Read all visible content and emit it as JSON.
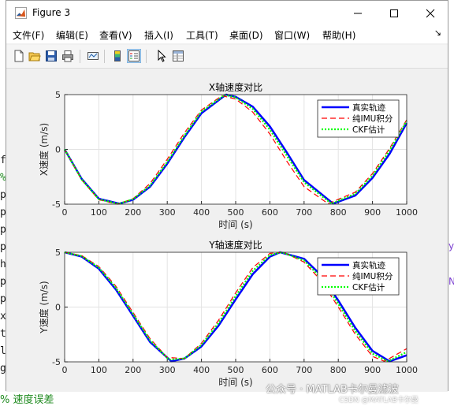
{
  "window": {
    "title": "Figure 3"
  },
  "menu": [
    "文件(F)",
    "编辑(E)",
    "查看(V)",
    "插入(I)",
    "工具(T)",
    "桌面(D)",
    "窗口(W)",
    "帮助(H)"
  ],
  "toolbar": [
    "new-figure-icon",
    "open-file-icon",
    "save-icon",
    "print-icon",
    "link-plot-icon",
    "insert-colorbar-icon",
    "insert-legend-icon",
    "pointer-icon",
    "property-inspector-icon"
  ],
  "background_editor": {
    "left_chars": [
      "f",
      "%",
      "p",
      "p",
      "p",
      "p",
      "h",
      "p",
      "p",
      "x",
      "t",
      "l",
      "g"
    ],
    "bottom_text": "% 速度误差",
    "right_chars": [
      "y",
      "N"
    ]
  },
  "watermark": {
    "text": "公众号 · MATLAB卡尔曼滤波",
    "sub": "CSDN @MATLAB卡尔曼"
  },
  "chart_data": [
    {
      "type": "line",
      "title": "X轴速度对比",
      "xlabel": "时间 (s)",
      "ylabel": "X速度 (m/s)",
      "xlim": [
        0,
        1000
      ],
      "ylim": [
        -5,
        5
      ],
      "xticks": [
        "0",
        "100",
        "200",
        "300",
        "400",
        "500",
        "600",
        "700",
        "800",
        "900",
        "1000"
      ],
      "yticks": [
        "-5",
        "0",
        "5"
      ],
      "grid": true,
      "legend_position": "top-right",
      "series": [
        {
          "name": "真实轨迹",
          "color": "#0000ff",
          "style": "solid",
          "x": [
            0,
            50,
            100,
            160,
            200,
            250,
            300,
            350,
            400,
            472,
            500,
            550,
            600,
            650,
            700,
            785,
            850,
            900,
            950,
            1000
          ],
          "y": [
            0,
            -2.7,
            -4.5,
            -4.95,
            -4.6,
            -3.4,
            -1.3,
            1.1,
            3.3,
            5.0,
            4.8,
            3.9,
            2.1,
            -0.3,
            -2.8,
            -4.95,
            -4.2,
            -2.6,
            -0.4,
            2.4
          ]
        },
        {
          "name": "纯IMU积分",
          "color": "#ff0000",
          "style": "dashed",
          "x": [
            0,
            50,
            100,
            155,
            200,
            250,
            300,
            350,
            400,
            460,
            500,
            550,
            600,
            650,
            700,
            770,
            850,
            900,
            950,
            1000
          ],
          "y": [
            0,
            -2.8,
            -4.6,
            -5.0,
            -4.5,
            -3.1,
            -0.9,
            1.5,
            3.6,
            4.9,
            4.6,
            3.4,
            1.4,
            -1.1,
            -3.4,
            -4.95,
            -3.9,
            -2.2,
            0.1,
            2.7
          ]
        },
        {
          "name": "CKF估计",
          "color": "#00ff00",
          "style": "dotted",
          "x": [
            0,
            50,
            100,
            158,
            200,
            250,
            300,
            350,
            400,
            468,
            500,
            550,
            600,
            650,
            700,
            780,
            850,
            900,
            950,
            1000
          ],
          "y": [
            0,
            -2.75,
            -4.55,
            -4.97,
            -4.55,
            -3.3,
            -1.15,
            1.25,
            3.45,
            4.97,
            4.75,
            3.7,
            1.8,
            -0.6,
            -3.0,
            -4.95,
            -4.05,
            -2.4,
            -0.1,
            2.6
          ]
        }
      ]
    },
    {
      "type": "line",
      "title": "Y轴速度对比",
      "xlabel": "时间 (s)",
      "ylabel": "Y速度 (m/s)",
      "xlim": [
        0,
        1000
      ],
      "ylim": [
        -5,
        5
      ],
      "xticks": [
        "0",
        "100",
        "200",
        "300",
        "400",
        "500",
        "600",
        "700",
        "800",
        "900",
        "1000"
      ],
      "yticks": [
        "-5",
        "0",
        "5"
      ],
      "grid": true,
      "legend_position": "top-right",
      "series": [
        {
          "name": "真实轨迹",
          "color": "#0000ff",
          "style": "solid",
          "x": [
            0,
            50,
            100,
            150,
            200,
            250,
            312,
            350,
            400,
            450,
            500,
            550,
            600,
            630,
            700,
            750,
            800,
            850,
            900,
            950,
            1000
          ],
          "y": [
            5.0,
            4.6,
            3.5,
            1.6,
            -0.8,
            -3.2,
            -4.95,
            -4.7,
            -3.6,
            -1.7,
            0.7,
            3.0,
            4.6,
            5.0,
            4.4,
            2.9,
            0.6,
            -1.9,
            -4.0,
            -4.95,
            -4.4
          ]
        },
        {
          "name": "纯IMU积分",
          "color": "#ff0000",
          "style": "dashed",
          "x": [
            0,
            50,
            100,
            150,
            200,
            250,
            300,
            350,
            400,
            450,
            500,
            550,
            600,
            640,
            700,
            750,
            800,
            850,
            900,
            935,
            1000
          ],
          "y": [
            5.0,
            4.7,
            3.7,
            1.9,
            -0.5,
            -2.9,
            -4.6,
            -4.7,
            -3.3,
            -1.2,
            1.3,
            3.6,
            4.9,
            5.0,
            4.1,
            2.4,
            0.0,
            -2.5,
            -4.5,
            -4.95,
            -3.8
          ]
        },
        {
          "name": "CKF估计",
          "color": "#00ff00",
          "style": "dotted",
          "x": [
            0,
            50,
            100,
            150,
            200,
            250,
            305,
            350,
            400,
            450,
            500,
            550,
            600,
            635,
            700,
            750,
            800,
            850,
            900,
            945,
            1000
          ],
          "y": [
            5.0,
            4.65,
            3.6,
            1.75,
            -0.65,
            -3.05,
            -4.8,
            -4.7,
            -3.45,
            -1.45,
            1.0,
            3.3,
            4.75,
            5.0,
            4.25,
            2.65,
            0.3,
            -2.2,
            -4.25,
            -4.95,
            -4.1
          ]
        }
      ]
    }
  ]
}
